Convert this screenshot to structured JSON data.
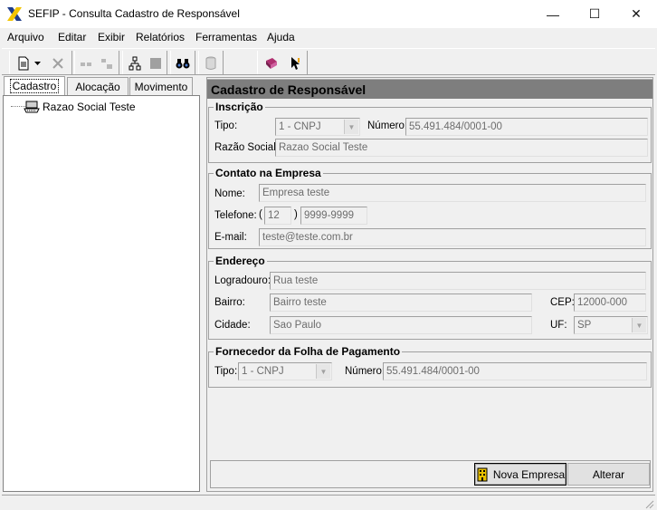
{
  "window": {
    "title": "SEFIP - Consulta Cadastro de Responsável",
    "minimize_glyph": "—",
    "maximize_glyph": "☐",
    "close_glyph": "✕"
  },
  "menu": [
    {
      "label": "Arquivo"
    },
    {
      "label": "Editar"
    },
    {
      "label": "Exibir"
    },
    {
      "label": "Relatórios"
    },
    {
      "label": "Ferramentas"
    },
    {
      "label": "Ajuda"
    }
  ],
  "toolbar": {
    "icons": [
      "new-document-icon",
      "dropdown-arrow-icon",
      "delete-icon",
      "tree-icon",
      "tree-disabled-icon",
      "network-icon",
      "stop-icon",
      "binoculars-search-icon",
      "database-icon",
      "book-help-icon",
      "pointer-help-icon"
    ]
  },
  "tabs": [
    {
      "label": "Cadastro",
      "active": true
    },
    {
      "label": "Alocação",
      "active": false
    },
    {
      "label": "Movimento",
      "active": false
    }
  ],
  "tree": {
    "items": [
      {
        "label": "Razao Social Teste",
        "icon": "keyboard-icon"
      }
    ]
  },
  "panel": {
    "title": "Cadastro de Responsável",
    "inscricao": {
      "legend": "Inscrição",
      "tipo_label": "Tipo:",
      "tipo_value": "1 - CNPJ",
      "numero_label": "Número:",
      "numero_value": "55.491.484/0001-00",
      "razao_label": "Razão Social:",
      "razao_value": "Razao Social Teste"
    },
    "contato": {
      "legend": "Contato na Empresa",
      "nome_label": "Nome:",
      "nome_value": "Empresa teste",
      "telefone_label": "Telefone:",
      "ddd_open": "(",
      "ddd_value": "12",
      "ddd_close": ")",
      "telefone_value": "9999-9999",
      "email_label": "E-mail:",
      "email_value": "teste@teste.com.br"
    },
    "endereco": {
      "legend": "Endereço",
      "logradouro_label": "Logradouro:",
      "logradouro_value": "Rua teste",
      "bairro_label": "Bairro:",
      "bairro_value": "Bairro teste",
      "cep_label": "CEP:",
      "cep_value": "12000-000",
      "cidade_label": "Cidade:",
      "cidade_value": "Sao Paulo",
      "uf_label": "UF:",
      "uf_value": "SP"
    },
    "fornecedor": {
      "legend": "Fornecedor da Folha de Pagamento",
      "tipo_label": "Tipo:",
      "tipo_value": "1 - CNPJ",
      "numero_label": "Número:",
      "numero_value": "55.491.484/0001-00"
    },
    "buttons": {
      "nova_empresa": "Nova Empresa",
      "alterar": "Alterar"
    }
  },
  "colors": {
    "header_bg": "#7e7e7e",
    "window_bg": "#f0f0f0"
  }
}
